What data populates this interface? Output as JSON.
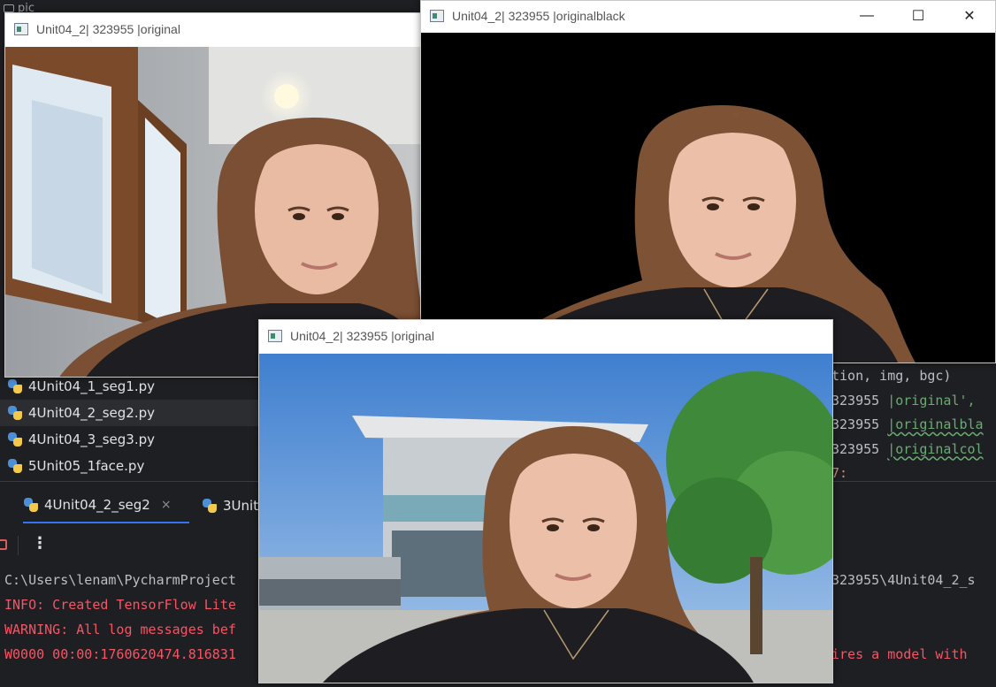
{
  "ide": {
    "top_label": "pic",
    "project_files": [
      {
        "name": "4Unit04_1_seg1.py",
        "selected": false
      },
      {
        "name": "4Unit04_2_seg2.py",
        "selected": true
      },
      {
        "name": "4Unit04_3_seg3.py",
        "selected": false
      },
      {
        "name": "5Unit05_1face.py",
        "selected": false
      }
    ],
    "code_lines": {
      "l1": "tion, img, bgc)",
      "l2_prefix": "323955 ",
      "l2_str": "|original',",
      "l3_prefix": "323955 ",
      "l3_str": "|originalbla",
      "l4_prefix": "323955 ",
      "l4_str": "|originalcol",
      "l5": "7:"
    },
    "run_tabs": [
      {
        "label": "4Unit04_2_seg2",
        "close": "×"
      },
      {
        "label": "3Unit"
      }
    ],
    "toolbar_more": "⋮",
    "console": {
      "line1": "C:\\Users\\lenam\\PycharmProject",
      "line1_right": "323955\\4Unit04_2_s",
      "line2": "INFO: Created TensorFlow Lite",
      "line3": "WARNING: All log messages bef",
      "line4": "W0000 00:00:1760620474.816831",
      "line4_right": "ires a model with"
    }
  },
  "windows": {
    "original": {
      "title": "Unit04_2| 323955 |original"
    },
    "black": {
      "title": "Unit04_2| 323955 |originalblack",
      "minimize": "—",
      "maximize": "☐",
      "close": "✕"
    },
    "colour": {
      "title": "Unit04_2| 323955 |original"
    }
  },
  "colors": {
    "ide_bg": "#1e1f22",
    "console_error": "#f75464",
    "string_green": "#6aab73",
    "accent_blue": "#3574f0"
  }
}
